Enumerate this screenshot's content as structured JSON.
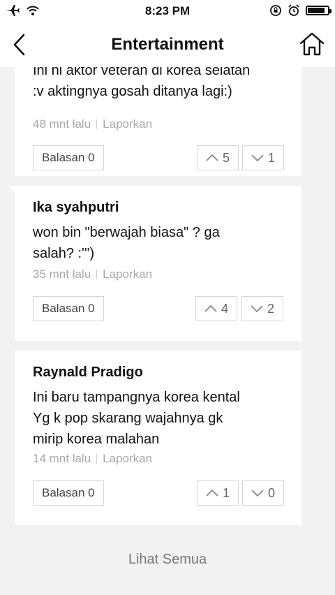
{
  "status_bar": {
    "time": "8:23 PM",
    "battery_level": 0.85
  },
  "nav": {
    "title": "Entertainment",
    "back_icon": "chevron-left-icon",
    "home_icon": "home-icon"
  },
  "comments": [
    {
      "author": "",
      "text": "Ini ni aktor veteran di korea selatan\n:v aktingnya gosah ditanya lagi:)",
      "time": "48 mnt lalu",
      "report_label": "Laporkan",
      "reply_label": "Balasan 0",
      "upvotes": "5",
      "downvotes": "1"
    },
    {
      "author": "Ika syahputri",
      "text": "won bin \"berwajah biasa\" ? ga\nsalah? :''')",
      "time": "35 mnt lalu",
      "report_label": "Laporkan",
      "reply_label": "Balasan 0",
      "upvotes": "4",
      "downvotes": "2"
    },
    {
      "author": "Raynald Pradigo",
      "text": "Ini baru tampangnya korea kental\nYg k pop skarang wajahnya gk\nmirip korea malahan",
      "time": "14 mnt lalu",
      "report_label": "Laporkan",
      "reply_label": "Balasan 0",
      "upvotes": "1",
      "downvotes": "0"
    }
  ],
  "footer": {
    "see_all_label": "Lihat Semua"
  }
}
